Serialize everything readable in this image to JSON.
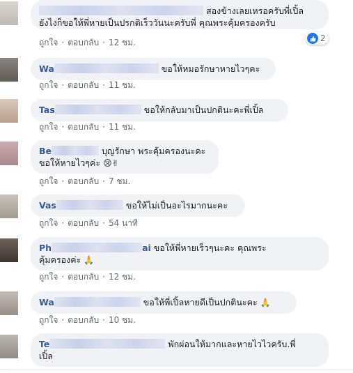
{
  "comments": [
    {
      "name": "",
      "line1": "สองข้างเลยเหรอครับพี่เปิ้ล",
      "line2": "ยังไงก็ขอให้พี่หายเป็นปรกติเร็ววันนะครับพี่ คุณพระคุ้มครองครับ",
      "like": "ถูกใจ",
      "reply": "ตอบกลับ",
      "time": "12 ชม.",
      "reaction_count": "2"
    },
    {
      "name": "Wa",
      "line1": "ขอให้หมอรักษาหายไวๆคะ",
      "like": "ถูกใจ",
      "reply": "ตอบกลับ",
      "time": "11 ชม."
    },
    {
      "name": "Tas",
      "line1": "ขอให้กลับมาเป็นปกตินะคะพี่เปิ้ล",
      "like": "ถูกใจ",
      "reply": "ตอบกลับ",
      "time": "11 ชม."
    },
    {
      "name": "Be",
      "line1": "บุญรักษา พระคุ้มครองนะคะ",
      "line2": "ขอให้หายไวๆค่ะ",
      "emoji": "😢✌",
      "like": "ถูกใจ",
      "reply": "ตอบกลับ",
      "time": "7 ชม."
    },
    {
      "name": "Vas",
      "line1": "ขอให้ไม่เป็นอะไรมากนะคะ",
      "like": "ถูกใจ",
      "reply": "ตอบกลับ",
      "time": "54 นาที"
    },
    {
      "name": "Ph",
      "name_tail": "ai",
      "line1": "ขอให้พี่หายเร็วๆนะคะ คุณพระ",
      "line2": "คุ้มครองค่ะ",
      "emoji": "🙏",
      "like": "ถูกใจ",
      "reply": "ตอบกลับ",
      "time": "12 ชม."
    },
    {
      "name": "Wa",
      "line1": "ขอให้พี่เปิ้ลหายดีเป็นปกตินะคะ",
      "emoji": "🙏",
      "like": "ถูกใจ",
      "reply": "ตอบกลับ",
      "time": "10 ชม."
    },
    {
      "name": "Te",
      "line1": "พักผ่อนให้มากและหายไวไวครับ.พี่",
      "line2": "เปิ้ล"
    }
  ],
  "colors": {
    "name": "#385898",
    "bubble": "#f0f2f5",
    "meta": "#65676b",
    "like_icon": "#1877f2"
  },
  "icons": {
    "reaction": "thumbs-up-icon"
  }
}
